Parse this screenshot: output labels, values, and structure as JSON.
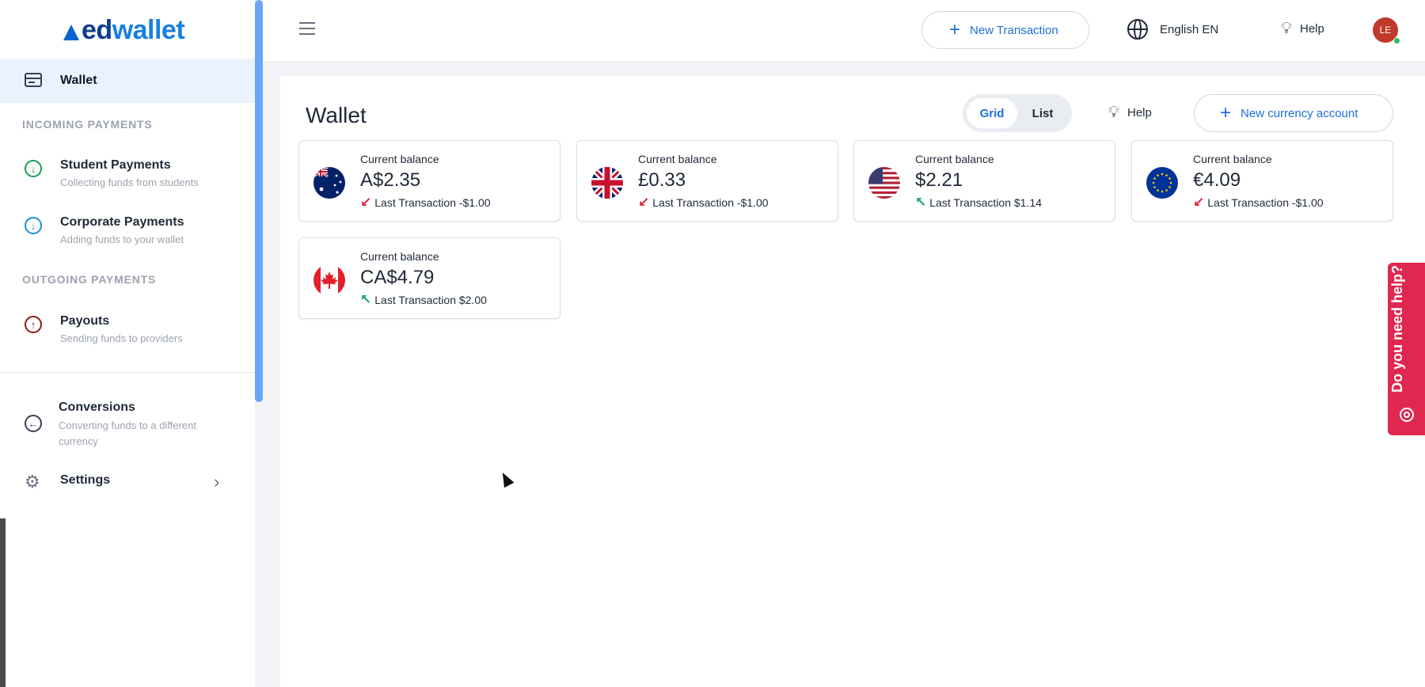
{
  "brand": {
    "logo_ed": "ed",
    "logo_wallet": "wallet"
  },
  "sidebar": {
    "wallet_label": "Wallet",
    "incoming_title": "INCOMING PAYMENTS",
    "outgoing_title": "OUTGOING PAYMENTS",
    "items": [
      {
        "title": "Student Payments",
        "sub": "Collecting funds from students",
        "icon": "arrow-down-circle-icon",
        "color": "#18a058"
      },
      {
        "title": "Corporate Payments",
        "sub": "Adding funds to your wallet",
        "icon": "arrow-down-circle-icon",
        "color": "#1d8fd6"
      },
      {
        "title": "Payouts",
        "sub": "Sending funds to providers",
        "icon": "arrow-up-circle-icon",
        "color": "#8b1a1a"
      },
      {
        "title": "Conversions",
        "sub": "Converting funds to a different currency",
        "icon": "arrow-left-circle-icon",
        "color": "#374151"
      },
      {
        "title": "Settings",
        "icon": "gear-icon"
      }
    ]
  },
  "topbar": {
    "new_transaction": "New Transaction",
    "language": "English EN",
    "help": "Help",
    "avatar_initials": "LE"
  },
  "main": {
    "title": "Wallet",
    "view_grid": "Grid",
    "view_list": "List",
    "help": "Help",
    "new_account": "New currency account",
    "cards": [
      {
        "label": "Current balance",
        "amount": "A$2.35",
        "last": "Last Transaction -$1.00",
        "direction": "down",
        "flag": "australia"
      },
      {
        "label": "Current balance",
        "amount": "£0.33",
        "last": "Last Transaction -$1.00",
        "direction": "down",
        "flag": "uk"
      },
      {
        "label": "Current balance",
        "amount": "$2.21",
        "last": "Last Transaction $1.14",
        "direction": "up",
        "flag": "usa"
      },
      {
        "label": "Current balance",
        "amount": "€4.09",
        "last": "Last Transaction -$1.00",
        "direction": "down",
        "flag": "eu"
      },
      {
        "label": "Current balance",
        "amount": "CA$4.79",
        "last": "Last Transaction $2.00",
        "direction": "up",
        "flag": "canada"
      }
    ]
  },
  "helpdesk": {
    "text": "Do you need help?"
  },
  "colors": {
    "accent": "#1d6fd6",
    "brand_dark": "#0b3d91",
    "brand_light": "#1680e0",
    "negative": "#e11d2e",
    "positive": "#15a36b",
    "help_tab": "#e0274f"
  }
}
